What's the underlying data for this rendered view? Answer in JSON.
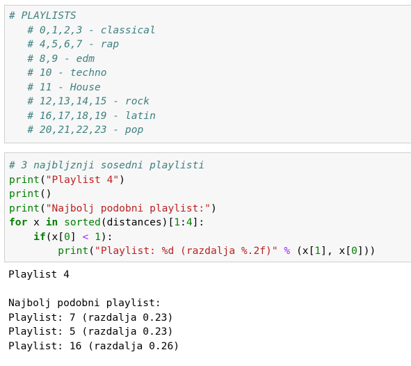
{
  "cells": [
    {
      "type": "code",
      "lines": [
        "# PLAYLISTS",
        "   # 0,1,2,3 - classical",
        "   # 4,5,6,7 - rap",
        "   # 8,9 - edm",
        "   # 10 - techno",
        "   # 11 - House",
        "   # 12,13,14,15 - rock",
        "   # 16,17,18,19 - latin",
        "   # 20,21,22,23 - pop"
      ]
    },
    {
      "type": "code",
      "line1_comment": "# 3 najbljznji sosedni playlisti",
      "line2": {
        "fn": "print",
        "open": "(",
        "str": "\"Playlist 4\"",
        "close": ")"
      },
      "line3": {
        "fn": "print",
        "parens": "()"
      },
      "line4": {
        "fn": "print",
        "open": "(",
        "str": "\"Najbolj podobni playlist:\"",
        "close": ")"
      },
      "line5": {
        "for": "for",
        "var": " x ",
        "in": "in",
        "sp": " ",
        "sorted": "sorted",
        "rest": "(distances)[",
        "n1": "1",
        "colon": ":",
        "n4": "4",
        "end": "]:"
      },
      "line6": {
        "indent": "    ",
        "if": "if",
        "a": "(x[",
        "n0": "0",
        "b": "] ",
        "lt": "<",
        "sp": " ",
        "n1": "1",
        "c": "):"
      },
      "line7": {
        "indent": "        ",
        "fn": "print",
        "open": "(",
        "str": "\"Playlist: %d (razdalja %.2f)\"",
        "sp": " ",
        "pct": "%",
        "a": " (x[",
        "n1": "1",
        "b": "], x[",
        "n0": "0",
        "c": "]))"
      }
    }
  ],
  "output": {
    "lines": [
      "Playlist 4",
      "",
      "Najbolj podobni playlist:",
      "Playlist: 7 (razdalja 0.23)",
      "Playlist: 5 (razdalja 0.23)",
      "Playlist: 16 (razdalja 0.26)"
    ]
  }
}
